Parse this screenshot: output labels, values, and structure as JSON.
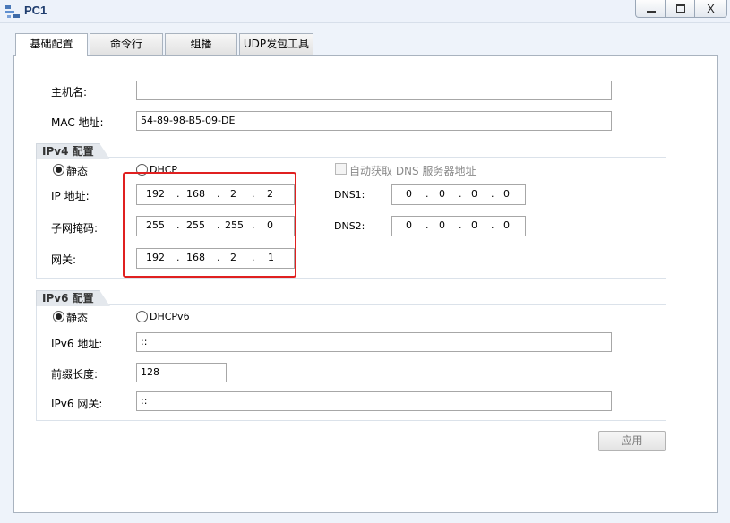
{
  "window": {
    "title": "PC1",
    "controls": {
      "minimize": "—",
      "maximize": "☐",
      "close": "X"
    }
  },
  "tabs": [
    {
      "label": "基础配置",
      "active": true
    },
    {
      "label": "命令行",
      "active": false
    },
    {
      "label": "组播",
      "active": false
    },
    {
      "label": "UDP发包工具",
      "active": false
    }
  ],
  "basic": {
    "hostname_label": "主机名:",
    "hostname_value": "",
    "mac_label": "MAC 地址:",
    "mac_value": "54-89-98-B5-09-DE"
  },
  "ipv4": {
    "group_title": "IPv4 配置",
    "static_label": "静态",
    "dhcp_label": "DHCP",
    "mode": "static",
    "auto_dns_label": "自动获取 DNS 服务器地址",
    "auto_dns_checked": false,
    "ip_label": "IP 地址:",
    "ip": [
      "192",
      "168",
      "2",
      "2"
    ],
    "mask_label": "子网掩码:",
    "mask": [
      "255",
      "255",
      "255",
      "0"
    ],
    "gateway_label": "网关:",
    "gateway": [
      "192",
      "168",
      "2",
      "1"
    ],
    "dns1_label": "DNS1:",
    "dns1": [
      "0",
      "0",
      "0",
      "0"
    ],
    "dns2_label": "DNS2:",
    "dns2": [
      "0",
      "0",
      "0",
      "0"
    ]
  },
  "ipv6": {
    "group_title": "IPv6 配置",
    "static_label": "静态",
    "dhcp_label": "DHCPv6",
    "mode": "static",
    "address_label": "IPv6 地址:",
    "address_value": "::",
    "prefix_label": "前缀长度:",
    "prefix_value": "128",
    "gateway_label": "IPv6 网关:",
    "gateway_value": "::"
  },
  "apply_label": "应用",
  "colors": {
    "title": "#1f3d6e",
    "highlight": "#e02020",
    "panel_bg": "#ffffff",
    "window_bg": "#eef3fa"
  }
}
